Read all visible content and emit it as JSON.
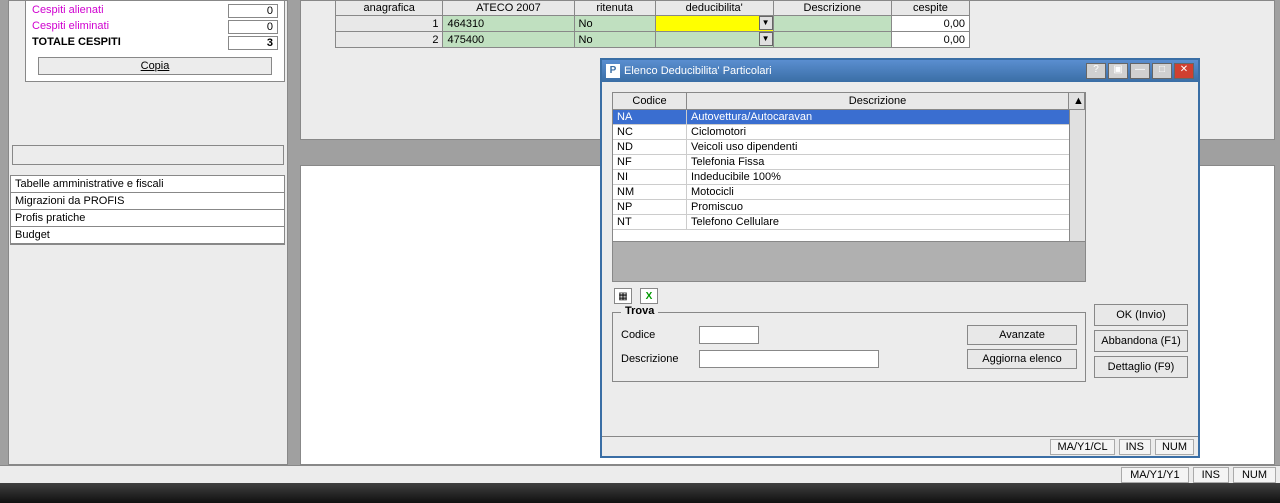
{
  "summary": {
    "rows": [
      {
        "label": "Cespiti alienati",
        "value": "0",
        "class": "red"
      },
      {
        "label": "Cespiti eliminati",
        "value": "0",
        "class": "red"
      },
      {
        "label": "TOTALE CESPITI",
        "value": "3",
        "class": "bold"
      }
    ],
    "copy_btn": "Copia"
  },
  "nav": [
    "Tabelle amministrative e fiscali",
    "Migrazioni da PROFIS",
    "Profis pratiche",
    "Budget"
  ],
  "top_table": {
    "headers": [
      "anagrafica",
      "ATECO 2007",
      "ritenuta",
      "deducibilita'",
      "Descrizione",
      "cespite"
    ],
    "rows": [
      {
        "n": "1",
        "ateco": "464310",
        "rit": "No",
        "ded": "",
        "desc": "",
        "cesp": "0,00",
        "yellow": true
      },
      {
        "n": "2",
        "ateco": "475400",
        "rit": "No",
        "ded": "",
        "desc": "",
        "cesp": "0,00",
        "yellow": false
      }
    ]
  },
  "dialog": {
    "title": "Elenco Deducibilita' Particolari",
    "headers": {
      "cod": "Codice",
      "desc": "Descrizione"
    },
    "rows": [
      {
        "cod": "NA",
        "desc": "Autovettura/Autocaravan",
        "sel": true
      },
      {
        "cod": "NC",
        "desc": "Ciclomotori"
      },
      {
        "cod": "ND",
        "desc": "Veicoli uso dipendenti"
      },
      {
        "cod": "NF",
        "desc": "Telefonia Fissa"
      },
      {
        "cod": "NI",
        "desc": "Indeducibile 100%"
      },
      {
        "cod": "NM",
        "desc": "Motocicli"
      },
      {
        "cod": "NP",
        "desc": "Promiscuo"
      },
      {
        "cod": "NT",
        "desc": "Telefono Cellulare"
      }
    ],
    "trova": {
      "title": "Trova",
      "codice_lbl": "Codice",
      "desc_lbl": "Descrizione",
      "avanzate": "Avanzate",
      "aggiorna": "Aggiorna elenco"
    },
    "buttons": {
      "ok": "OK (Invio)",
      "abbandona": "Abbandona (F1)",
      "dettaglio": "Dettaglio (F9)"
    },
    "status": {
      "path": "MA/Y1/CL",
      "ins": "INS",
      "num": "NUM"
    }
  },
  "main_status": {
    "path": "MA/Y1/Y1",
    "ins": "INS",
    "num": "NUM"
  }
}
